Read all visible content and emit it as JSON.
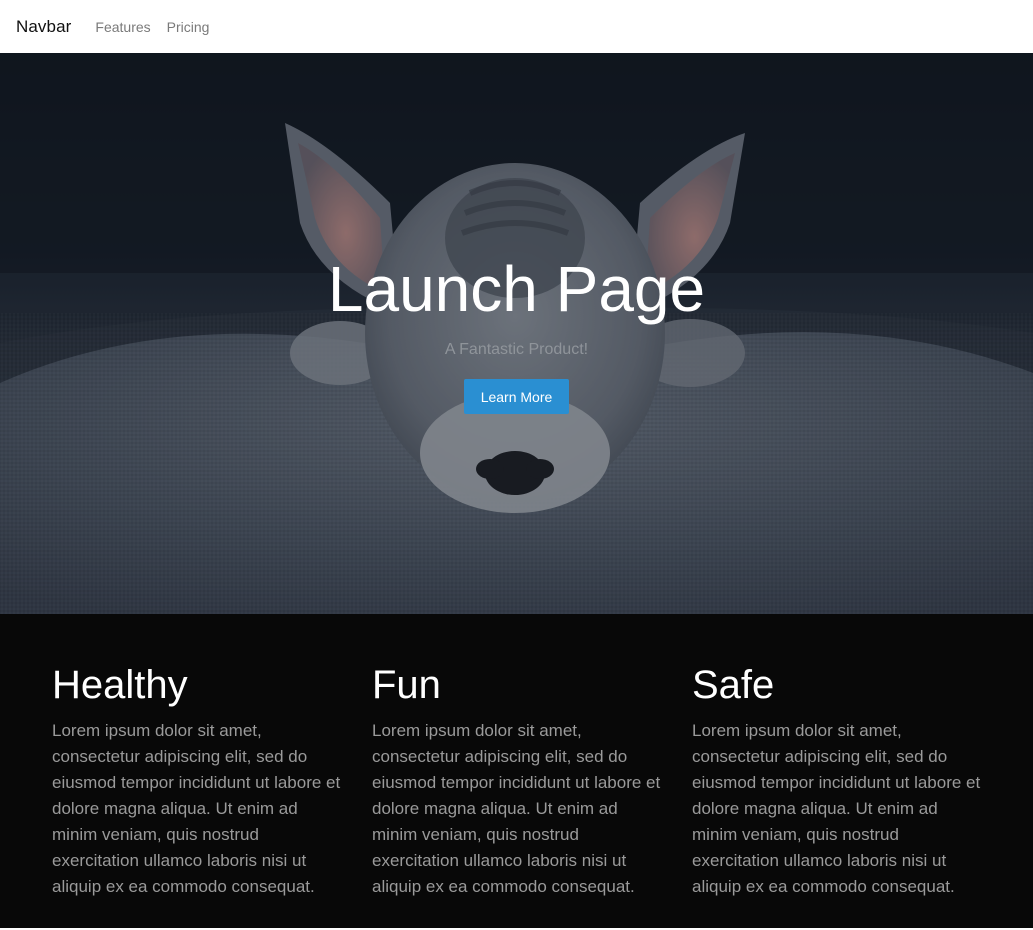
{
  "navbar": {
    "brand": "Navbar",
    "links": [
      {
        "label": "Features"
      },
      {
        "label": "Pricing"
      }
    ]
  },
  "hero": {
    "title": "Launch Page",
    "subtitle": "A Fantastic Product!",
    "button_label": "Learn More",
    "button_color": "#2a8fd2"
  },
  "features": [
    {
      "title": "Healthy",
      "text": "Lorem ipsum dolor sit amet, consectetur adipiscing elit, sed do eiusmod tempor incididunt ut labore et dolore magna aliqua. Ut enim ad minim veniam, quis nostrud exercitation ullamco laboris nisi ut aliquip ex ea commodo consequat."
    },
    {
      "title": "Fun",
      "text": "Lorem ipsum dolor sit amet, consectetur adipiscing elit, sed do eiusmod tempor incididunt ut labore et dolore magna aliqua. Ut enim ad minim veniam, quis nostrud exercitation ullamco laboris nisi ut aliquip ex ea commodo consequat."
    },
    {
      "title": "Safe",
      "text": "Lorem ipsum dolor sit amet, consectetur adipiscing elit, sed do eiusmod tempor incididunt ut labore et dolore magna aliqua. Ut enim ad minim veniam, quis nostrud exercitation ullamco laboris nisi ut aliquip ex ea commodo consequat."
    }
  ]
}
